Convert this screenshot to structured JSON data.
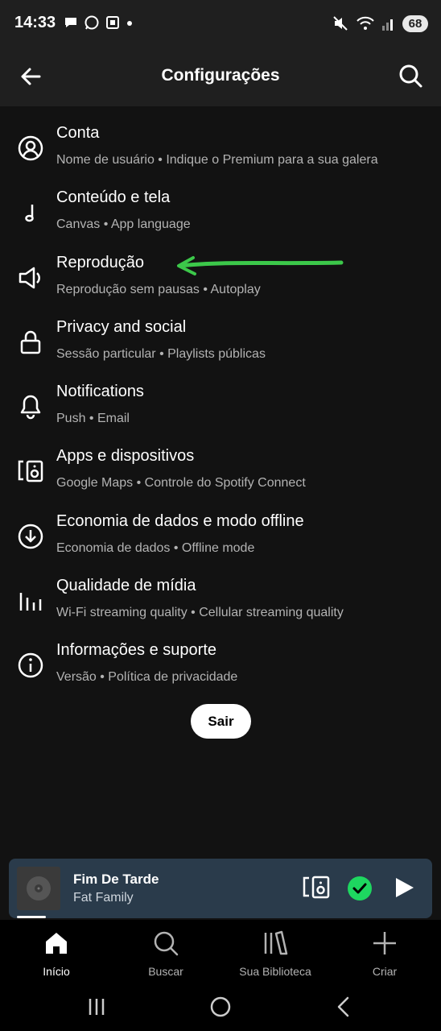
{
  "status_bar": {
    "time": "14:33",
    "battery": "68"
  },
  "header": {
    "title": "Configurações"
  },
  "settings": [
    {
      "icon": "user-circle-icon",
      "title": "Conta",
      "subtitle": "Nome de usuário • Indique o Premium para a sua galera"
    },
    {
      "icon": "music-note-icon",
      "title": "Conteúdo e tela",
      "subtitle": "Canvas • App language"
    },
    {
      "icon": "speaker-icon",
      "title": "Reprodução",
      "subtitle": "Reprodução sem pausas • Autoplay"
    },
    {
      "icon": "lock-icon",
      "title": "Privacy and social",
      "subtitle": "Sessão particular • Playlists públicas"
    },
    {
      "icon": "bell-icon",
      "title": "Notifications",
      "subtitle": "Push • Email"
    },
    {
      "icon": "devices-icon",
      "title": "Apps e dispositivos",
      "subtitle": "Google Maps • Controle do Spotify Connect"
    },
    {
      "icon": "download-icon",
      "title": "Economia de dados e modo offline",
      "subtitle": "Economia de dados • Offline mode"
    },
    {
      "icon": "bars-icon",
      "title": "Qualidade de mídia",
      "subtitle": "Wi-Fi streaming quality • Cellular streaming quality"
    },
    {
      "icon": "info-icon",
      "title": "Informações e suporte",
      "subtitle": "Versão • Política de privacidade"
    }
  ],
  "logout_label": "Sair",
  "mini_player": {
    "title": "Fim De Tarde",
    "artist": "Fat Family"
  },
  "bottom_nav": [
    {
      "icon": "home-icon",
      "label": "Início",
      "active": true
    },
    {
      "icon": "search-icon",
      "label": "Buscar",
      "active": false
    },
    {
      "icon": "library-icon",
      "label": "Sua Biblioteca",
      "active": false
    },
    {
      "icon": "plus-icon",
      "label": "Criar",
      "active": false
    }
  ],
  "colors": {
    "background": "#121212",
    "header": "#1f1f1f",
    "subtitle": "#b3b3b3",
    "mini_player": "#2a3b4b",
    "accent_green": "#1ed760",
    "annotation_green": "#3cc84a"
  }
}
